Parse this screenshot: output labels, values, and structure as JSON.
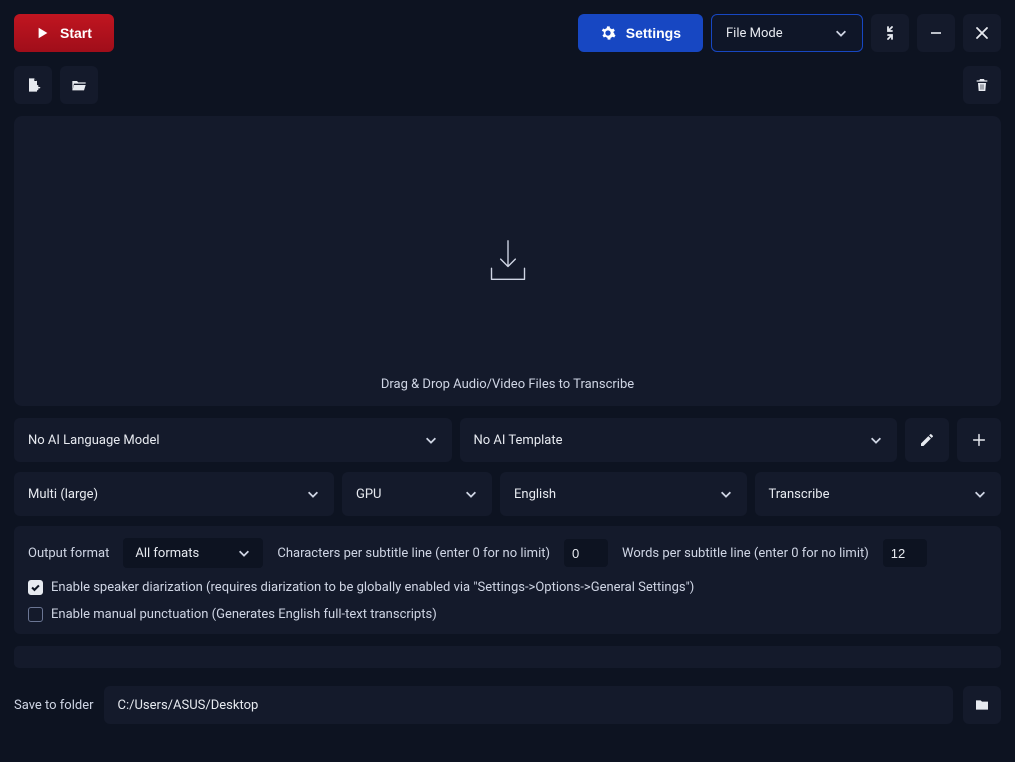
{
  "topbar": {
    "start_label": "Start",
    "settings_label": "Settings",
    "mode_selected": "File Mode"
  },
  "dropzone": {
    "hint": "Drag & Drop Audio/Video Files to Transcribe"
  },
  "models": {
    "ai_model_selected": "No AI Language Model",
    "ai_template_selected": "No AI Template"
  },
  "engine": {
    "model_selected": "Multi (large)",
    "device_selected": "GPU",
    "language_selected": "English",
    "task_selected": "Transcribe"
  },
  "options": {
    "output_format_label": "Output format",
    "output_format_selected": "All formats",
    "chars_per_line_label": "Characters per subtitle line (enter 0 for no limit)",
    "chars_per_line_value": "0",
    "words_per_line_label": "Words per subtitle line (enter 0 for no limit)",
    "words_per_line_value": "12",
    "diarization_checked": true,
    "diarization_label": "Enable speaker diarization (requires diarization to be globally enabled via \"Settings->Options->General Settings\")",
    "punctuation_checked": false,
    "punctuation_label": "Enable manual punctuation (Generates English full-text transcripts)"
  },
  "save": {
    "label": "Save to folder",
    "path": "C:/Users/ASUS/Desktop"
  }
}
